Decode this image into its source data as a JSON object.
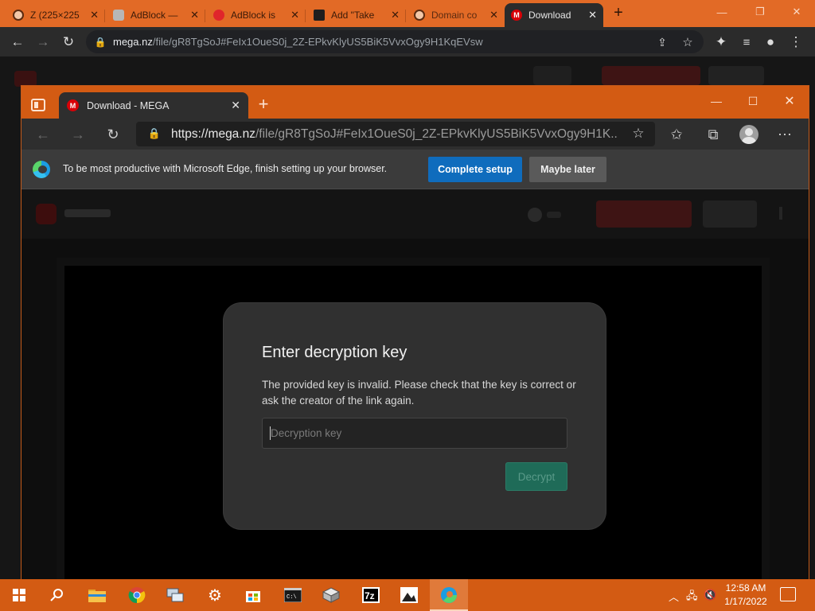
{
  "chrome": {
    "tabs": [
      {
        "title": "Z (225×225",
        "fav_color": "#f2c7a8",
        "fav_glyph": ""
      },
      {
        "title": "AdBlock —",
        "fav_color": "#b7b7b7",
        "fav_glyph": ""
      },
      {
        "title": "AdBlock is",
        "fav_color": "#e0252b",
        "fav_glyph": ""
      },
      {
        "title": "Add \"Take",
        "fav_color": "#1e1e1e",
        "fav_glyph": ""
      },
      {
        "title": "Domain co",
        "fav_color": "#f2c7a8",
        "fav_glyph": ""
      },
      {
        "title": "Download",
        "fav_color": "#d90007",
        "fav_glyph": "M"
      }
    ],
    "url_host": "mega.nz",
    "url_rest": "/file/gR8TgSoJ#FeIx1OueS0j_2Z-EPkvKlyUS5BiK5VvxOgy9H1KqEVsw"
  },
  "edge": {
    "tab_title": "Download - MEGA",
    "tab_fav_glyph": "M",
    "url_prefix": "https://",
    "url_host": "mega.nz",
    "url_rest": "/file/gR8TgSoJ#FeIx1OueS0j_2Z-EPkvKlyUS5BiK5VvxOgy9H1K...",
    "infobar": {
      "message": "To be most productive with Microsoft Edge, finish setting up your browser.",
      "primary_label": "Complete setup",
      "secondary_label": "Maybe later"
    }
  },
  "dialog": {
    "title": "Enter decryption key",
    "message": "The provided key is invalid. Please check that the key is correct or ask the creator of the link again.",
    "input_placeholder": "Decryption key",
    "input_value": "",
    "button_label": "Decrypt"
  },
  "taskbar": {
    "time": "12:58 AM",
    "date": "1/17/2022",
    "apps": [
      "start-icon",
      "search-icon",
      "file-explorer-icon",
      "chrome-icon",
      "network-icon",
      "settings-icon",
      "store-icon",
      "terminal-icon",
      "package-icon",
      "7zip-icon",
      "photos-icon",
      "edge-icon"
    ]
  },
  "colors": {
    "accent": "#d35b13",
    "edge_blue": "#0f6cbd",
    "mega_red": "#d90007",
    "decrypt_green": "#1f6b58"
  }
}
